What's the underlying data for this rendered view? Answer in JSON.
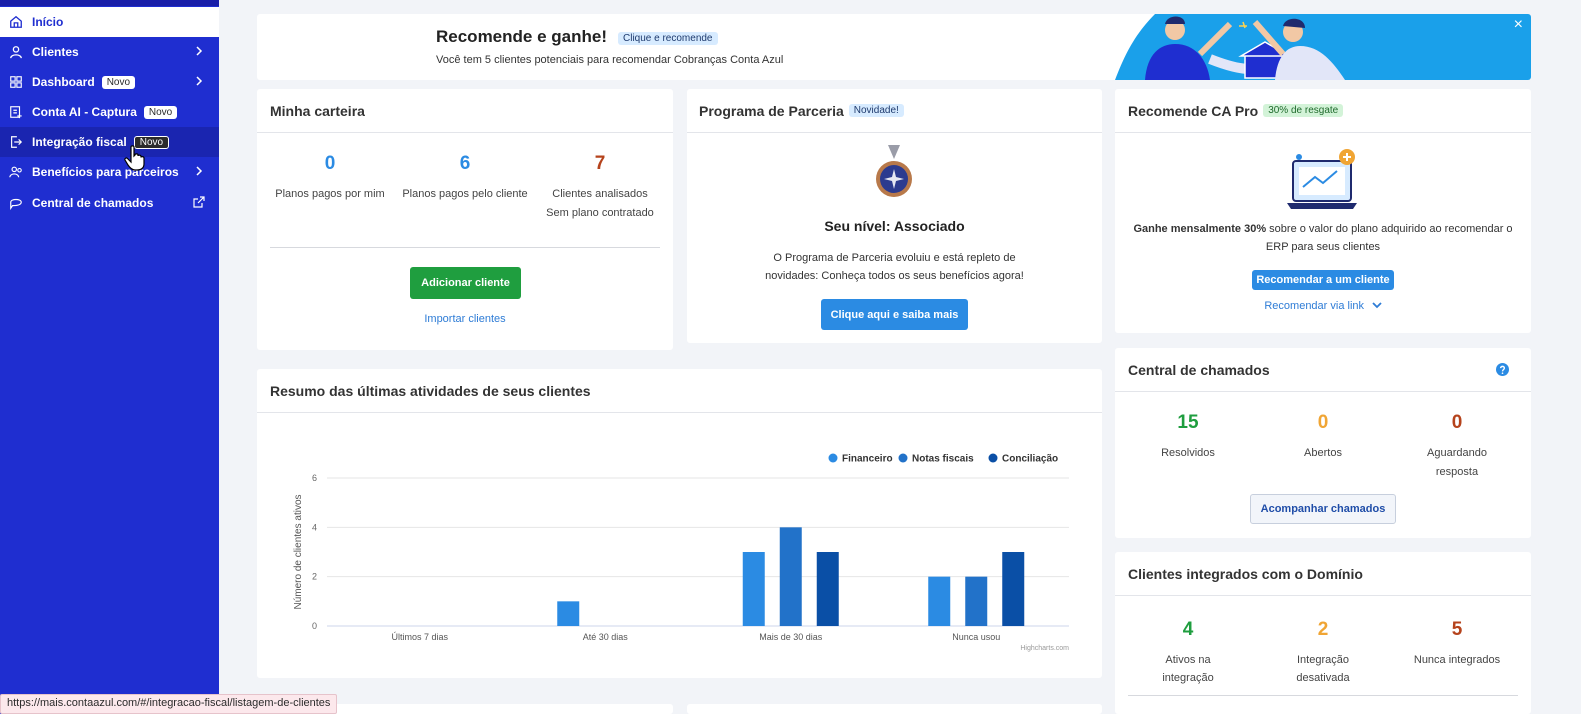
{
  "sidebar": {
    "items": [
      {
        "label": "Início",
        "icon": "home-icon"
      },
      {
        "label": "Clientes",
        "icon": "user-icon"
      },
      {
        "label": "Dashboard",
        "icon": "dashboard-icon",
        "badge": "Novo"
      },
      {
        "label": "Conta AI - Captura",
        "icon": "capture-icon",
        "badge": "Novo"
      },
      {
        "label": "Integração fiscal",
        "icon": "fiscal-icon",
        "badge": "Novo"
      },
      {
        "label": "Benefícios para parceiros",
        "icon": "partners-icon"
      },
      {
        "label": "Central de chamados",
        "icon": "chat-icon"
      }
    ]
  },
  "banner": {
    "title": "Recomende e ganhe!",
    "tag": "Clique e recomende",
    "subtitle": "Você tem 5 clientes potenciais para recomendar Cobranças Conta Azul",
    "close": "×"
  },
  "carteira": {
    "title": "Minha carteira",
    "stats": [
      {
        "value": "0",
        "label": "Planos pagos por mim",
        "color": "#2b8be3"
      },
      {
        "value": "6",
        "label": "Planos pagos pelo cliente",
        "color": "#2b8be3"
      },
      {
        "value": "7",
        "label": "Clientes analisados",
        "label2": "Sem plano contratado",
        "color": "#b5431c"
      }
    ],
    "add_button": "Adicionar cliente",
    "import_link": "Importar clientes"
  },
  "parceria": {
    "title": "Programa de Parceria",
    "tag": "Novidade!",
    "level": "Seu nível: Associado",
    "desc1": "O Programa de Parceria evoluiu e está repleto de",
    "desc2": "novidades: Conheça todos os seus benefícios agora!",
    "button": "Clique aqui e saiba mais"
  },
  "capro": {
    "title": "Recomende CA Pro",
    "tag": "30% de resgate",
    "desc_bold": "Ganhe mensalmente 30%",
    "desc_rest": " sobre o valor do plano adquirido ao recomendar o",
    "desc2": "ERP para seus clientes",
    "button": "Recomendar a um cliente",
    "link": "Recomendar via link"
  },
  "chamados": {
    "title": "Central de chamados",
    "stats": [
      {
        "value": "15",
        "label": "Resolvidos",
        "color": "#1f9e3f"
      },
      {
        "value": "0",
        "label": "Abertos",
        "color": "#f0a534"
      },
      {
        "value": "0",
        "label": "Aguardando",
        "label2": "resposta",
        "color": "#b5431c"
      }
    ],
    "button": "Acompanhar chamados"
  },
  "dominio": {
    "title": "Clientes integrados com o Domínio",
    "stats": [
      {
        "value": "4",
        "label": "Ativos na",
        "label2": "integração",
        "color": "#1f9e3f"
      },
      {
        "value": "2",
        "label": "Integração",
        "label2": "desativada",
        "color": "#f0a534"
      },
      {
        "value": "5",
        "label": "Nunca integrados",
        "color": "#b5431c"
      }
    ]
  },
  "activity": {
    "title": "Resumo das últimas atividades de seus clientes",
    "credit": "Highcharts.com"
  },
  "chart_data": {
    "type": "bar",
    "title": "",
    "xlabel": "",
    "ylabel": "Número de clientes ativos",
    "ylim": [
      0,
      6
    ],
    "yticks": [
      "0",
      "2",
      "4",
      "6"
    ],
    "categories": [
      "Últimos 7 dias",
      "Até 30 dias",
      "Mais de 30 dias",
      "Nunca usou"
    ],
    "series": [
      {
        "name": "Financeiro",
        "values": [
          0,
          1,
          3,
          2
        ],
        "color": "#2b8be3"
      },
      {
        "name": "Notas fiscais",
        "values": [
          0,
          0,
          4,
          2
        ],
        "color": "#2272c9"
      },
      {
        "name": "Conciliação",
        "values": [
          0,
          0,
          3,
          3
        ],
        "color": "#0a4fa6"
      }
    ],
    "legend": "top-right",
    "grid": true
  },
  "status_url": "https://mais.contaazul.com/#/integracao-fiscal/listagem-de-clientes"
}
